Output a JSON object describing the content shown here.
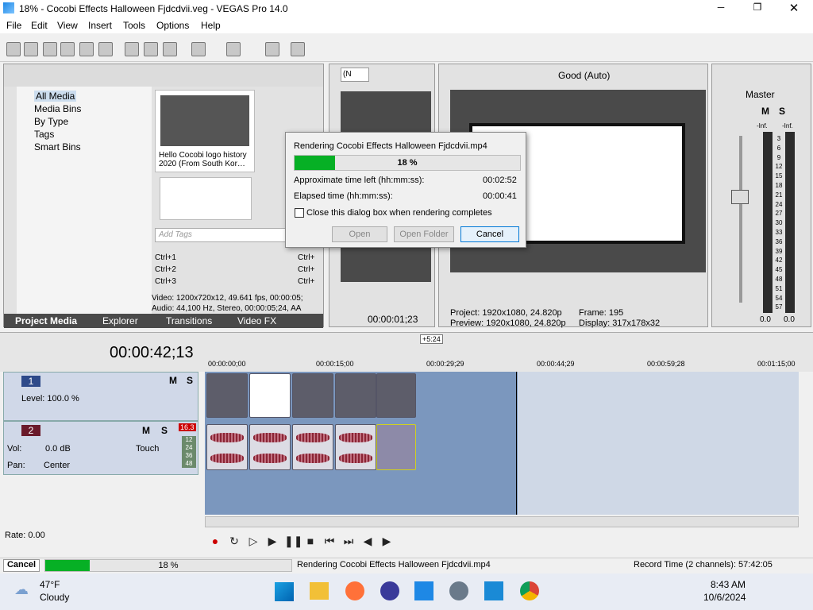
{
  "window": {
    "title": "18% - Cocobi Effects Halloween Fjdcdvii.veg - VEGAS Pro 14.0"
  },
  "menu": [
    "File",
    "Edit",
    "View",
    "Insert",
    "Tools",
    "Options",
    "Help"
  ],
  "media_tree": [
    "All Media",
    "Media Bins",
    "By Type",
    "Tags",
    "Smart Bins"
  ],
  "media_panel": {
    "thumb1_caption": "Hello Cocobi logo history 2020 (From South Kor…",
    "tag_placeholder": "Add Tags",
    "shortcuts": [
      "Ctrl+1",
      "Ctrl+2",
      "Ctrl+3"
    ],
    "shortcuts_right": [
      "Ctrl+",
      "Ctrl+",
      "Ctrl+"
    ],
    "video_info": "Video: 1200x720x12, 49.641 fps, 00:00:05;",
    "audio_info": "Audio: 44,100 Hz, Stereo, 00:00:05;24, AA"
  },
  "tabs": [
    "Project Media",
    "Explorer",
    "Transitions",
    "Video FX"
  ],
  "trimmer": {
    "dropdown": "(N",
    "timecode": "00:00:01;23"
  },
  "preview": {
    "quality": "Good (Auto)",
    "project_label": "Project:",
    "project_val": "1920x1080, 24.820p",
    "preview_label": "Preview:",
    "preview_val": "1920x1080, 24.820p",
    "frame_label": "Frame:",
    "frame_val": "195",
    "display_label": "Display:",
    "display_val": "317x178x32"
  },
  "master": {
    "title": "Master",
    "m": "M",
    "s": "S",
    "inf1": "-Inf.",
    "inf2": "-Inf.",
    "scale": [
      "3",
      "6",
      "9",
      "12",
      "15",
      "18",
      "21",
      "24",
      "27",
      "30",
      "33",
      "36",
      "39",
      "42",
      "45",
      "48",
      "51",
      "54",
      "57"
    ],
    "v1": "0.0",
    "v2": "0.0"
  },
  "dialog": {
    "title": "Rendering Cocobi Effects Halloween Fjdcdvii.mp4",
    "progress": 0.18,
    "progress_text": "18 %",
    "left_label": "Approximate time left (hh:mm:ss):",
    "left_val": "00:02:52",
    "elapsed_label": "Elapsed time (hh:mm:ss):",
    "elapsed_val": "00:00:41",
    "checkbox": "Close this dialog box when rendering completes",
    "open": "Open",
    "open_folder": "Open Folder",
    "cancel": "Cancel"
  },
  "timeline": {
    "time": "00:00:42;13",
    "marker": "+5:24",
    "ticks": [
      "00:00:00;00",
      "00:00:15;00",
      "00:00:29;29",
      "00:00:44;29",
      "00:00:59;28",
      "00:01:15;00"
    ]
  },
  "track1": {
    "num": "1",
    "m": "M",
    "s": "S",
    "level": "Level: 100.0 %"
  },
  "track2": {
    "num": "2",
    "m": "M",
    "s": "S",
    "vol_label": "Vol:",
    "vol": "0.0 dB",
    "pan_label": "Pan:",
    "pan": "Center",
    "mode": "Touch",
    "peak": "16.3",
    "mini": [
      "12",
      "24",
      "36",
      "48"
    ]
  },
  "transport": {
    "rate": "Rate: 0.00"
  },
  "status": {
    "cancel": "Cancel",
    "progress": 0.18,
    "progress_text": "18 %",
    "rendering": "Rendering Cocobi Effects Halloween Fjdcdvii.mp4",
    "record": "Record Time (2 channels): 57:42:05"
  },
  "taskbar": {
    "temp": "47°F",
    "weather": "Cloudy",
    "time": "8:43 AM",
    "date": "10/6/2024"
  },
  "colors": {
    "accent": "#0078d7",
    "progress": "#06b025",
    "timeline_bg": "#7b97be",
    "track_header_bg": "#d0d8e8"
  }
}
